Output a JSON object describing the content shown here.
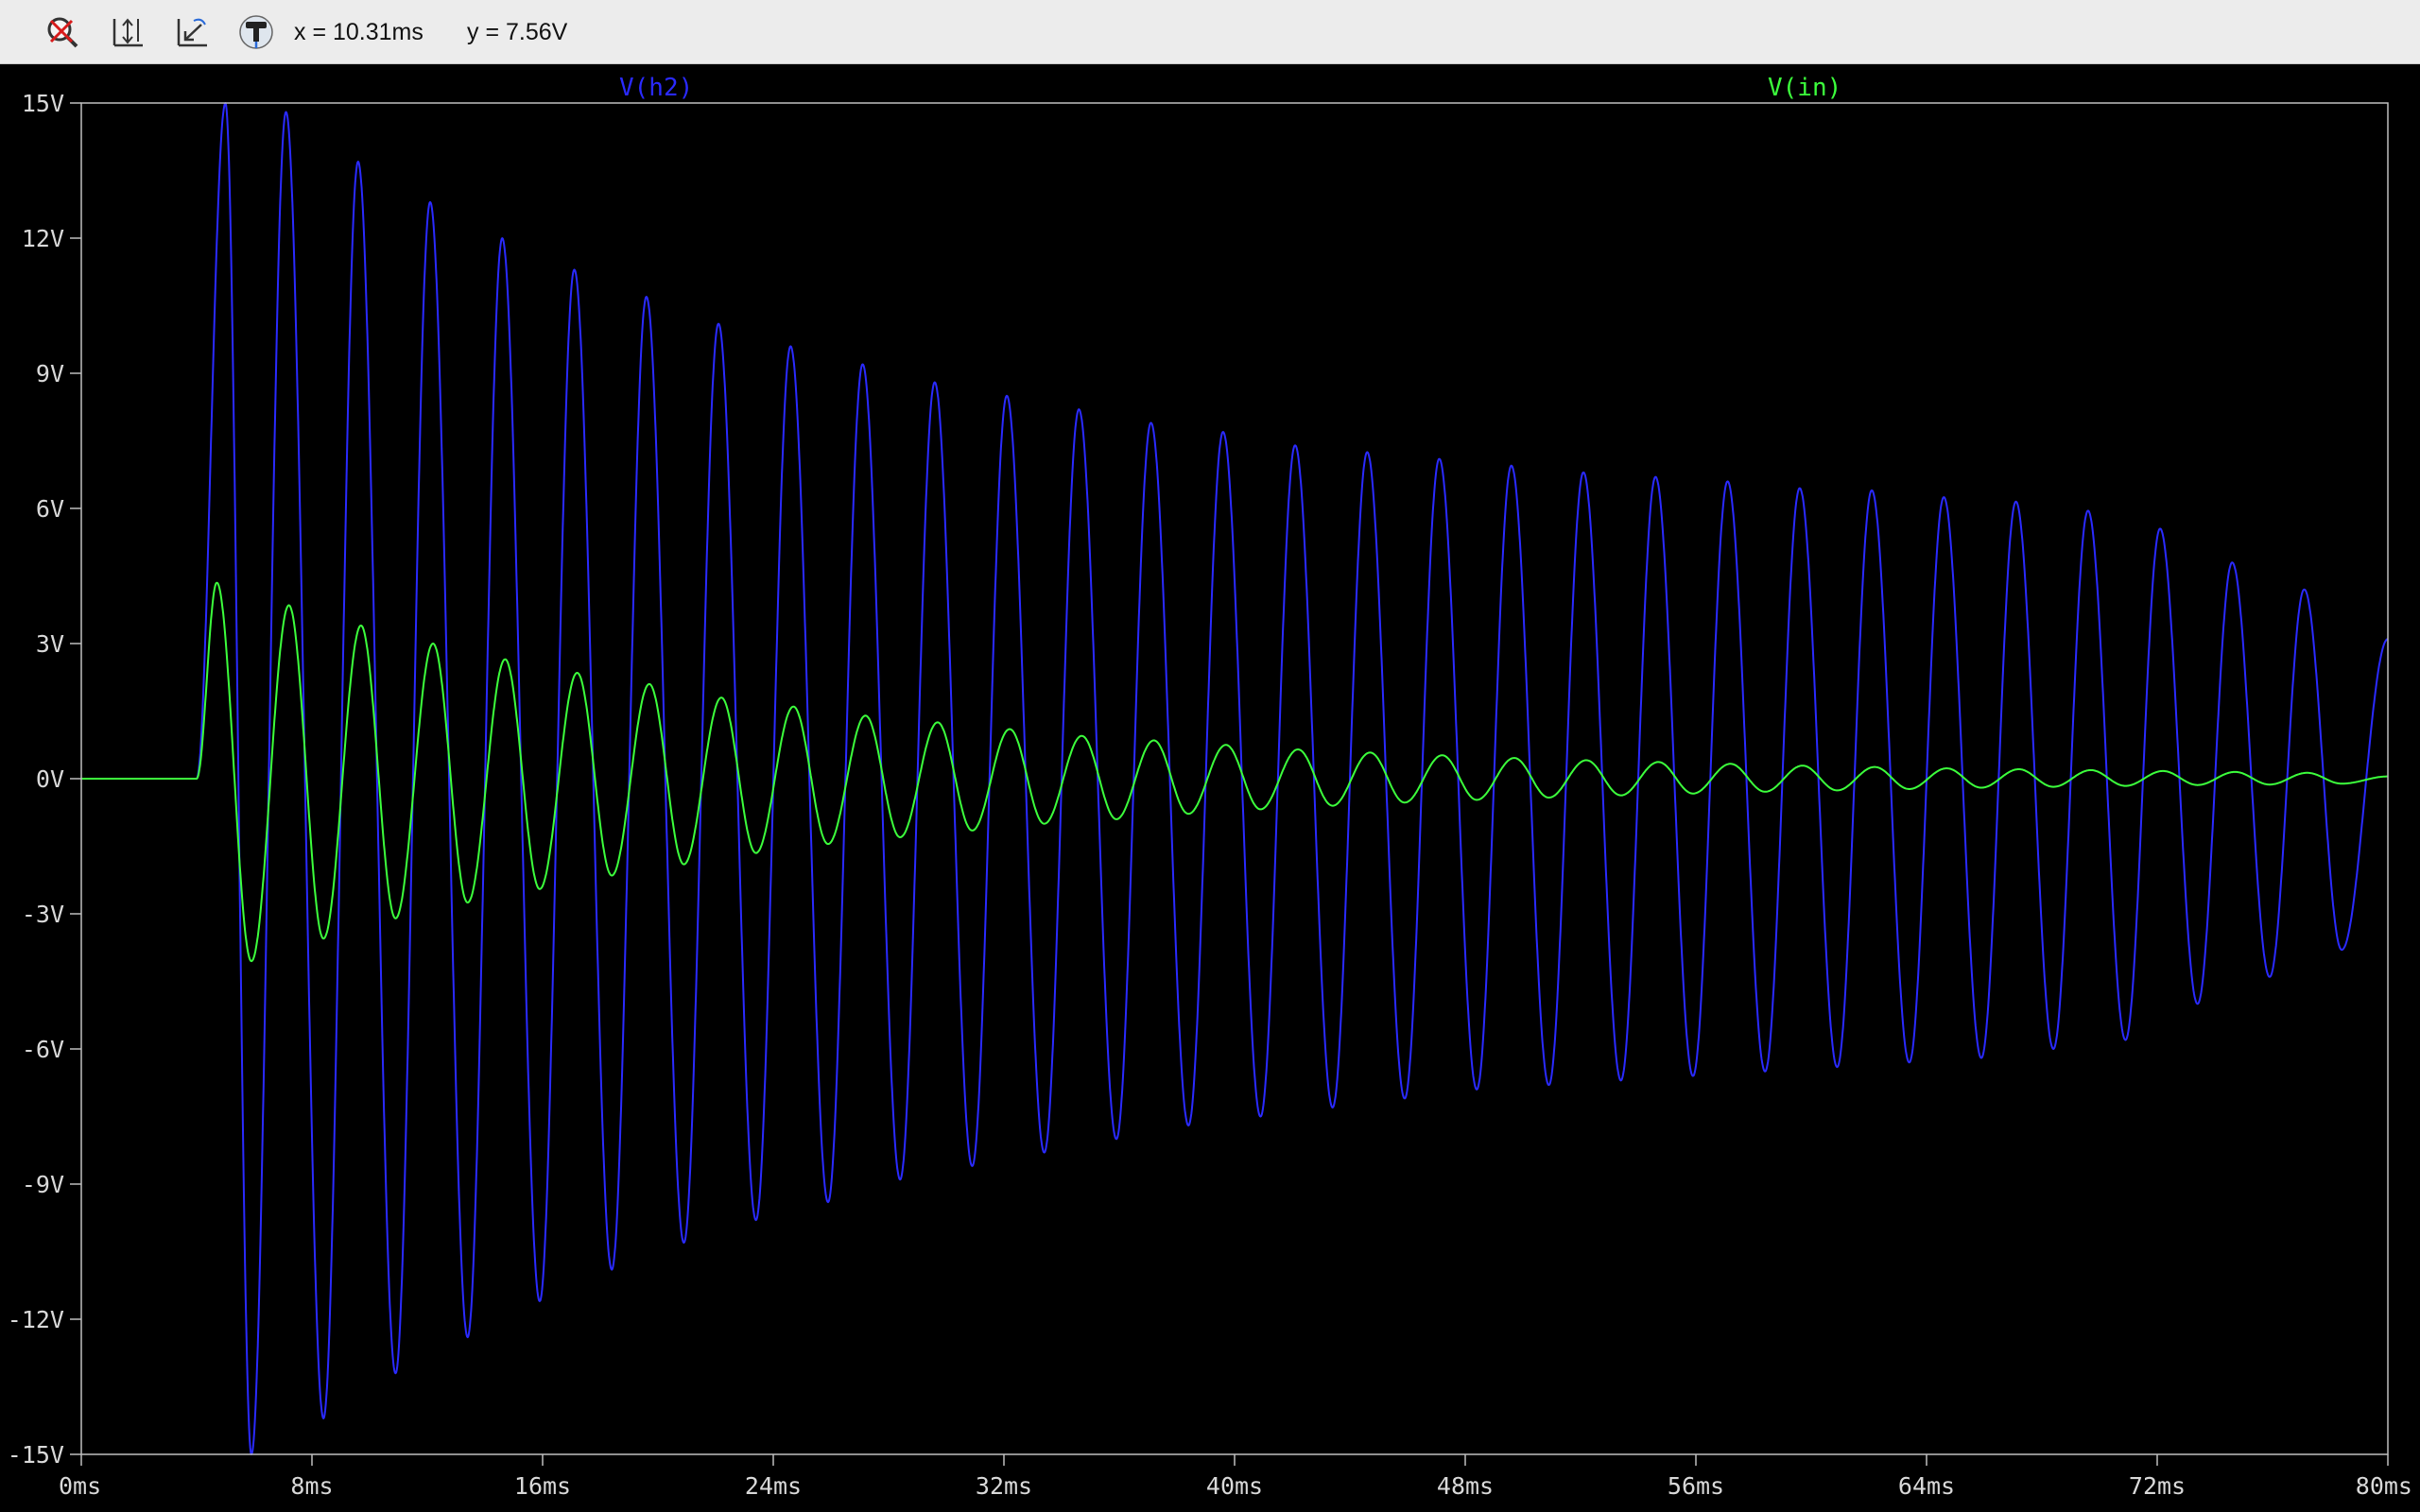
{
  "toolbar": {
    "tools": [
      {
        "icon": "zoom-cancel-icon"
      },
      {
        "icon": "autorange-icon"
      },
      {
        "icon": "zoom-back-icon"
      },
      {
        "icon": "probe-icon"
      }
    ],
    "readout_x": "x = 10.31ms",
    "readout_y": "y = 7.56V"
  },
  "colors": {
    "v_h2": "#2a2aff",
    "v_in": "#3cff3c",
    "background": "#000000",
    "axis": "#bfbfbf"
  },
  "chart_data": {
    "type": "line",
    "title": "",
    "xlabel": "",
    "ylabel": "",
    "xlim": [
      0,
      80
    ],
    "ylim": [
      -15,
      15
    ],
    "x_unit": "ms",
    "y_unit": "V",
    "grid": false,
    "legend": "top",
    "x_ticks": [
      "0ms",
      "8ms",
      "16ms",
      "24ms",
      "32ms",
      "40ms",
      "48ms",
      "56ms",
      "64ms",
      "72ms",
      "80ms"
    ],
    "y_ticks": [
      "15V",
      "12V",
      "9V",
      "6V",
      "3V",
      "0V",
      "-3V",
      "-6V",
      "-9V",
      "-12V",
      "-15V"
    ],
    "series": [
      {
        "name": "V(h2)",
        "start_ms": 4.0,
        "period_ms": 2.5,
        "peaks": [
          [
            5.0,
            15.0
          ],
          [
            7.1,
            14.8
          ],
          [
            9.6,
            13.7
          ],
          [
            12.1,
            12.8
          ],
          [
            14.6,
            12.0
          ],
          [
            17.1,
            11.3
          ],
          [
            19.6,
            10.7
          ],
          [
            22.1,
            10.1
          ],
          [
            24.6,
            9.6
          ],
          [
            27.1,
            9.2
          ],
          [
            29.6,
            8.8
          ],
          [
            32.1,
            8.5
          ],
          [
            34.6,
            8.2
          ],
          [
            37.1,
            7.9
          ],
          [
            39.6,
            7.7
          ],
          [
            42.1,
            7.4
          ],
          [
            44.6,
            7.25
          ],
          [
            47.1,
            7.1
          ],
          [
            49.6,
            6.95
          ],
          [
            52.1,
            6.8
          ],
          [
            54.6,
            6.7
          ],
          [
            57.1,
            6.6
          ],
          [
            59.6,
            6.45
          ],
          [
            62.1,
            6.4
          ],
          [
            64.6,
            6.25
          ],
          [
            67.1,
            6.15
          ],
          [
            69.6,
            5.95
          ],
          [
            72.1,
            5.55
          ],
          [
            74.6,
            4.8
          ],
          [
            77.1,
            4.2
          ]
        ],
        "troughs": [
          [
            5.9,
            -15.0
          ],
          [
            8.4,
            -14.2
          ],
          [
            10.9,
            -13.2
          ],
          [
            13.4,
            -12.4
          ],
          [
            15.9,
            -11.6
          ],
          [
            18.4,
            -10.9
          ],
          [
            20.9,
            -10.3
          ],
          [
            23.4,
            -9.8
          ],
          [
            25.9,
            -9.4
          ],
          [
            28.4,
            -8.9
          ],
          [
            30.9,
            -8.6
          ],
          [
            33.4,
            -8.3
          ],
          [
            35.9,
            -8.0
          ],
          [
            38.4,
            -7.7
          ],
          [
            40.9,
            -7.5
          ],
          [
            43.4,
            -7.3
          ],
          [
            45.9,
            -7.1
          ],
          [
            48.4,
            -6.9
          ],
          [
            50.9,
            -6.8
          ],
          [
            53.4,
            -6.7
          ],
          [
            55.9,
            -6.6
          ],
          [
            58.4,
            -6.5
          ],
          [
            60.9,
            -6.4
          ],
          [
            63.4,
            -6.3
          ],
          [
            65.9,
            -6.2
          ],
          [
            68.4,
            -6.0
          ],
          [
            70.9,
            -5.8
          ],
          [
            73.4,
            -5.0
          ],
          [
            75.9,
            -4.4
          ],
          [
            78.4,
            -3.8
          ]
        ],
        "end_value": 3.1
      },
      {
        "name": "V(in)",
        "start_ms": 4.0,
        "period_ms": 2.5,
        "peaks": [
          [
            4.7,
            4.35
          ],
          [
            7.2,
            3.85
          ],
          [
            9.7,
            3.4
          ],
          [
            12.2,
            3.0
          ],
          [
            14.7,
            2.65
          ],
          [
            17.2,
            2.35
          ],
          [
            19.7,
            2.1
          ],
          [
            22.2,
            1.8
          ],
          [
            24.7,
            1.6
          ],
          [
            27.2,
            1.4
          ],
          [
            29.7,
            1.25
          ],
          [
            32.2,
            1.1
          ],
          [
            34.7,
            0.95
          ],
          [
            37.2,
            0.85
          ],
          [
            39.7,
            0.75
          ],
          [
            42.2,
            0.65
          ],
          [
            44.7,
            0.58
          ],
          [
            47.2,
            0.52
          ],
          [
            49.7,
            0.46
          ],
          [
            52.2,
            0.41
          ],
          [
            54.7,
            0.37
          ],
          [
            57.2,
            0.33
          ],
          [
            59.7,
            0.29
          ],
          [
            62.2,
            0.26
          ],
          [
            64.7,
            0.23
          ],
          [
            67.2,
            0.21
          ],
          [
            69.7,
            0.19
          ],
          [
            72.2,
            0.17
          ],
          [
            74.7,
            0.15
          ],
          [
            77.2,
            0.13
          ]
        ],
        "troughs": [
          [
            5.9,
            -4.05
          ],
          [
            8.4,
            -3.55
          ],
          [
            10.9,
            -3.1
          ],
          [
            13.4,
            -2.75
          ],
          [
            15.9,
            -2.45
          ],
          [
            18.4,
            -2.15
          ],
          [
            20.9,
            -1.9
          ],
          [
            23.4,
            -1.65
          ],
          [
            25.9,
            -1.45
          ],
          [
            28.4,
            -1.3
          ],
          [
            30.9,
            -1.15
          ],
          [
            33.4,
            -1.0
          ],
          [
            35.9,
            -0.9
          ],
          [
            38.4,
            -0.78
          ],
          [
            40.9,
            -0.68
          ],
          [
            43.4,
            -0.6
          ],
          [
            45.9,
            -0.53
          ],
          [
            48.4,
            -0.47
          ],
          [
            50.9,
            -0.42
          ],
          [
            53.4,
            -0.37
          ],
          [
            55.9,
            -0.33
          ],
          [
            58.4,
            -0.29
          ],
          [
            60.9,
            -0.26
          ],
          [
            63.4,
            -0.23
          ],
          [
            65.9,
            -0.2
          ],
          [
            68.4,
            -0.18
          ],
          [
            70.9,
            -0.16
          ],
          [
            73.4,
            -0.14
          ],
          [
            75.9,
            -0.13
          ],
          [
            78.4,
            -0.11
          ]
        ],
        "end_value": 0.05
      }
    ]
  }
}
